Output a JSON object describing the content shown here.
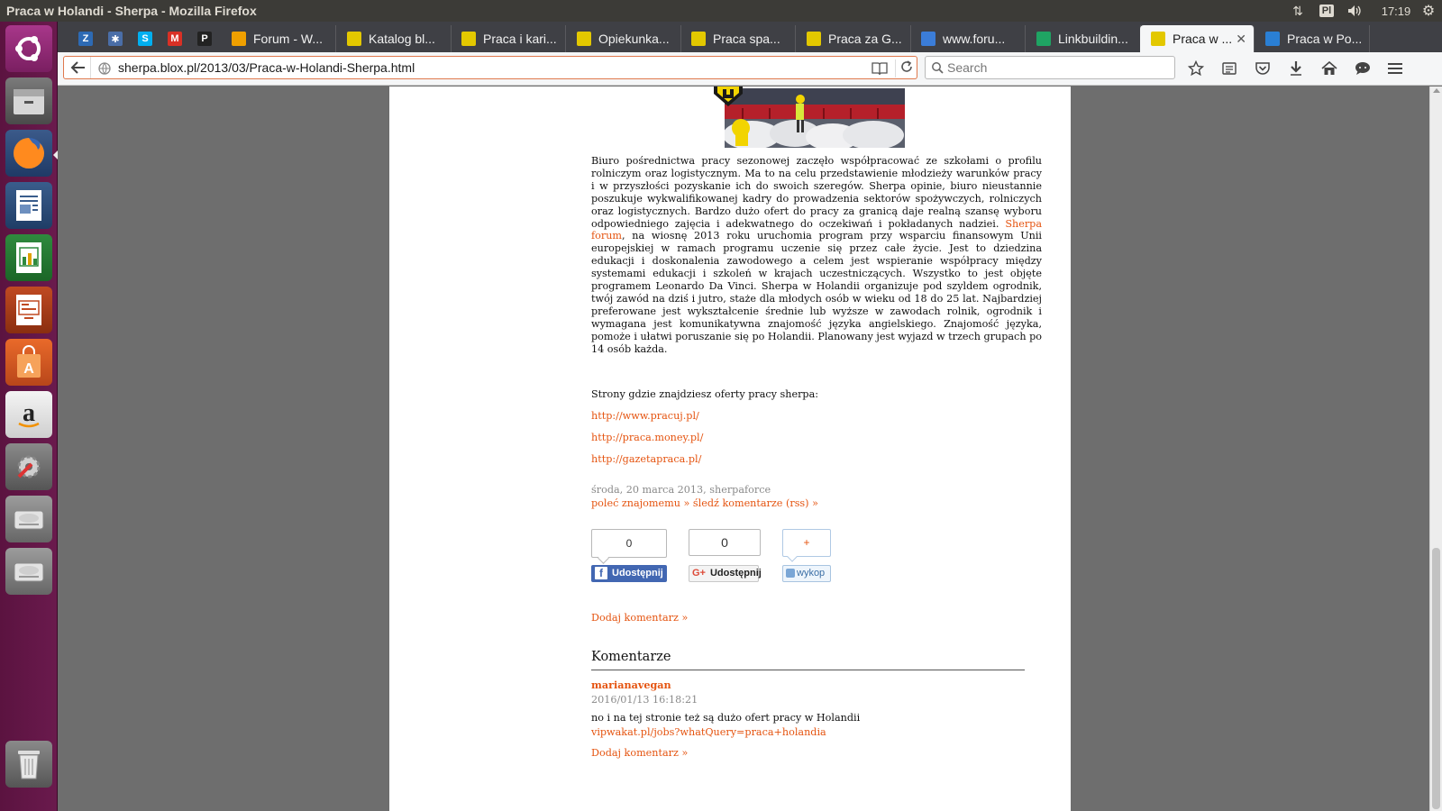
{
  "window": {
    "title": "Praca w Holandi - Sherpa - Mozilla Firefox"
  },
  "system_tray": {
    "language": "Pl",
    "clock": "17:19"
  },
  "launcher": {
    "items": [
      "ubuntu-icon",
      "files-icon",
      "firefox-icon",
      "libreoffice-writer-icon",
      "libreoffice-calc-icon",
      "libreoffice-impress-icon",
      "software-center-icon",
      "amazon-icon",
      "system-settings-icon",
      "disk-icon",
      "disk-icon",
      "trash-icon"
    ]
  },
  "tabs": {
    "pinned": [
      {
        "icon": "zotero-icon",
        "glyph": "Z",
        "color": "#2d6ab4"
      },
      {
        "icon": "app-icon",
        "glyph": "✱",
        "color": "#4a6ea8"
      },
      {
        "icon": "skype-icon",
        "glyph": "S",
        "color": "#00aff0"
      },
      {
        "icon": "gmail-icon",
        "glyph": "M",
        "color": "#d93025"
      },
      {
        "icon": "p-icon",
        "glyph": "P",
        "color": "#222222"
      }
    ],
    "items": [
      {
        "label": "Forum - W...",
        "icon": "forum-icon",
        "color": "#f0a000"
      },
      {
        "label": "Katalog bl...",
        "icon": "sherpa-icon",
        "color": "#e3c800"
      },
      {
        "label": "Praca i kari...",
        "icon": "sherpa-icon",
        "color": "#e3c800"
      },
      {
        "label": "Opiekunka...",
        "icon": "sherpa-icon",
        "color": "#e3c800"
      },
      {
        "label": "Praca spa...",
        "icon": "sherpa-icon",
        "color": "#e3c800"
      },
      {
        "label": "Praca za G...",
        "icon": "sherpa-icon",
        "color": "#e3c800"
      },
      {
        "label": "www.foru...",
        "icon": "bookmark-icon",
        "color": "#3b7dd8"
      },
      {
        "label": "Linkbuildin...",
        "icon": "sheets-icon",
        "color": "#1fa463"
      },
      {
        "label": "Praca w ...",
        "icon": "sherpa-icon",
        "color": "#e3c800",
        "active": true
      },
      {
        "label": "Praca w Po...",
        "icon": "folder-icon",
        "color": "#2a7fd4"
      }
    ]
  },
  "navbar": {
    "url": "sherpa.blox.pl/2013/03/Praca-w-Holandi-Sherpa.html",
    "search_placeholder": "Search"
  },
  "article": {
    "p1_before": "Biuro pośrednictwa pracy sezonowej zaczęło współpracować ze szkołami o profilu rolniczym oraz logistycznym. Ma to na celu przedstawienie młodzieży warunków pracy i w przyszłości pozyskanie ich do swoich szeregów. Sherpa opinie, biuro nieustannie poszukuje wykwalifikowanej kadry do prowadzenia sektorów spożywczych, rolniczych oraz logistycznych. Bardzo dużo ofert do pracy za granicą daje realną szansę wyboru odpowiedniego zajęcia i adekwatnego do oczekiwań i pokładanych nadziei.",
    "p1_link": "Sherpa forum",
    "p1_after": ", na wiosnę 2013 roku uruchomia program przy wsparciu finansowym Unii europejskiej w ramach programu uczenie się przez całe życie. Jest to dziedzina edukacji i doskonalenia zawodowego a celem jest wspieranie współpracy między systemami edukacji i szkoleń w krajach uczestniczących. Wszystko to jest objęte programem Leonardo Da Vinci. Sherpa w Holandii organizuje pod szyldem ogrodnik, twój zawód na dziś i jutro, staże dla młodych osób w wieku od 18 do 25 lat. Najbardziej preferowane jest wykształcenie średnie lub wyższe w zawodach rolnik, ogrodnik i wymagana jest komunikatywna znajomość języka angielskiego. Znajomość języka, pomoże i ułatwi poruszanie się po Holandii. Planowany jest wyjazd w trzech grupach po 14 osób każda.",
    "links_intro": "Strony gdzie znajdziesz oferty pracy sherpa:",
    "links": [
      "http://www.pracuj.pl/",
      "http://praca.money.pl/",
      "http://gazetapraca.pl/"
    ],
    "meta": "środa, 20 marca 2013, sherpaforce",
    "actions": "poleć znajomemu » śledź komentarze (rss) »"
  },
  "share": {
    "fb_count": "0",
    "fb_label": "Udostępnij",
    "gp_count": "0",
    "gp_label": "Udostępnij",
    "wykop_count": "+",
    "wykop_label": "wykop"
  },
  "comments": {
    "add_label": "Dodaj komentarz »",
    "heading": "Komentarze",
    "items": [
      {
        "author": "marianavegan",
        "date": "2016/01/13 16:18:21",
        "body": "no i na tej stronie też są dużo ofert pracy w Holandii",
        "link": "vipwakat.pl/jobs?whatQuery=praca+holandia"
      }
    ],
    "add_label_bottom": "Dodaj komentarz »"
  },
  "colors": {
    "link": "#e55410",
    "launcher_bg": "#5b1340",
    "tabstrip_bg": "#3f4045",
    "facebook": "#4267b2"
  }
}
